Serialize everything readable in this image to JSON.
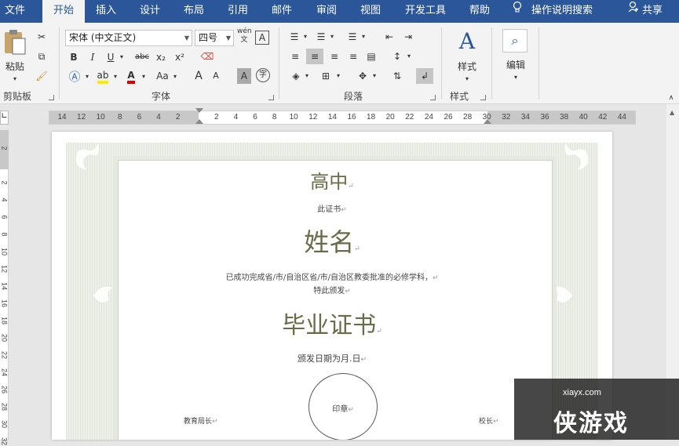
{
  "tabs": [
    {
      "label": "文件",
      "active": false
    },
    {
      "label": "开始",
      "active": true
    },
    {
      "label": "插入",
      "active": false
    },
    {
      "label": "设计",
      "active": false
    },
    {
      "label": "布局",
      "active": false
    },
    {
      "label": "引用",
      "active": false
    },
    {
      "label": "邮件",
      "active": false
    },
    {
      "label": "审阅",
      "active": false
    },
    {
      "label": "视图",
      "active": false
    },
    {
      "label": "开发工具",
      "active": false
    },
    {
      "label": "帮助",
      "active": false
    }
  ],
  "tell_me": "操作说明搜索",
  "share": "共享",
  "ribbon": {
    "clipboard": {
      "label": "剪贴板",
      "paste": "粘贴"
    },
    "font": {
      "label": "字体",
      "font_name": "宋体 (中文正文)",
      "font_size": "四号",
      "bold": "B",
      "italic": "I",
      "underline": "U",
      "strike": "abc",
      "sub": "x₂",
      "sup": "x²",
      "change_case": "Aa",
      "grow": "A",
      "shrink": "A",
      "wen": "wén",
      "wen_char": "文",
      "char_border": "A",
      "char_shade": "A",
      "enclose": "字"
    },
    "paragraph": {
      "label": "段落"
    },
    "styles": {
      "label": "样式",
      "button": "样式"
    },
    "editing": {
      "button": "编辑"
    }
  },
  "ruler": {
    "h_numbers": [
      "14",
      "12",
      "10",
      "8",
      "6",
      "4",
      "2",
      "",
      "2",
      "4",
      "6",
      "8",
      "10",
      "12",
      "14",
      "16",
      "18",
      "20",
      "22",
      "24",
      "26",
      "28",
      "30",
      "32",
      "34",
      "36",
      "38",
      "40",
      "42",
      "44"
    ],
    "v_numbers": [
      "2",
      "",
      "2",
      "4",
      "6",
      "8",
      "10",
      "12",
      "14",
      "16",
      "18",
      "20",
      "22",
      "24",
      "26",
      "28",
      "30",
      "32"
    ]
  },
  "document": {
    "school": "高中",
    "subtitle": "此证书",
    "name": "姓名",
    "body_line1": "已成功完成省/市/自治区省/市/自治区教委批准的必修学科，",
    "body_line2": "特此颁发",
    "title": "毕业证书",
    "date": "颁发日期为月.日",
    "seal": "印章",
    "left_sign": "教育局长",
    "right_sign": "校长"
  },
  "watermark": {
    "brand": "侠游戏",
    "url": "xiayx.com"
  },
  "colors": {
    "accent": "#2b579a",
    "cert_text": "#6b6b4a"
  }
}
